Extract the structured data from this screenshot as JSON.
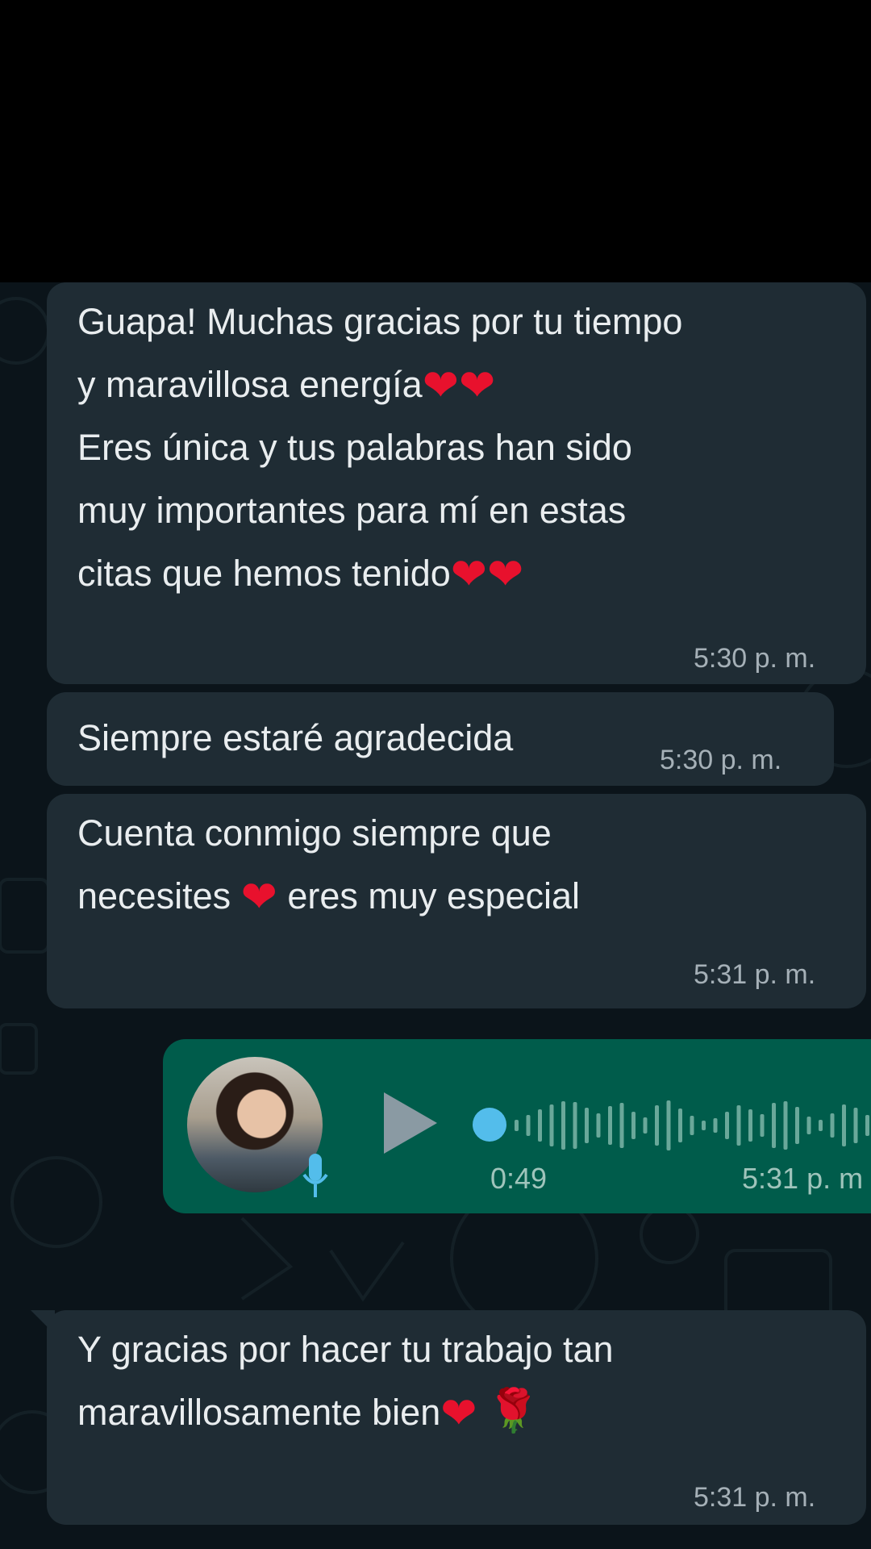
{
  "messages": [
    {
      "lines": [
        "Guapa! Muchas gracias por tu tiempo",
        "y maravillosa energía",
        "Eres única y tus palabras han sido",
        "muy importantes para mí en estas",
        "citas que hemos tenido"
      ],
      "time": "5:30 p. m."
    },
    {
      "lines": [
        "Siempre estaré agradecida"
      ],
      "time": "5:30 p. m."
    },
    {
      "lines": [
        "Cuenta conmigo siempre que",
        "necesites",
        "eres muy especial"
      ],
      "time": "5:31 p. m."
    },
    {
      "lines": [
        "Y gracias por hacer tu trabajo tan",
        "maravillosamente bien"
      ],
      "time": "5:31 p. m."
    }
  ],
  "voice_message": {
    "duration": "0:49",
    "time": "5:31 p. m",
    "progress": 0,
    "play_icon": "play-icon",
    "mic_icon": "mic-icon"
  },
  "emoji": {
    "heart": "❤",
    "rose": "🌹"
  },
  "colors": {
    "background": "#0b141a",
    "incoming_bubble": "#1f2c34",
    "outgoing_bubble": "#005c4b",
    "text": "#e9edef",
    "timestamp": "#a5b0b7",
    "playback_dot": "#53bdeb",
    "heart": "#e8112d"
  }
}
